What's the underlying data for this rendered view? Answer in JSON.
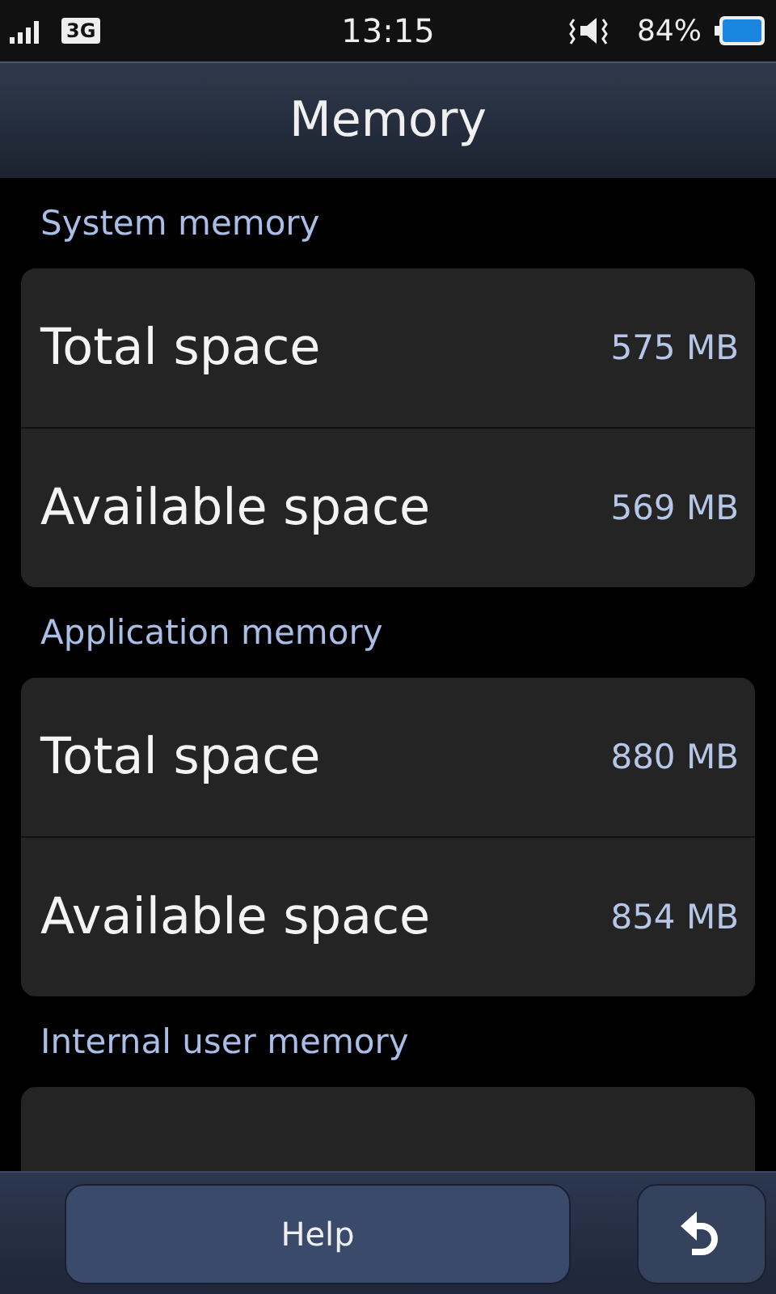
{
  "status_bar": {
    "network": "3G",
    "time": "13:15",
    "battery": "84%"
  },
  "title": "Memory",
  "sections": [
    {
      "heading": "System memory",
      "rows": [
        {
          "label": "Total space",
          "value": "575 MB"
        },
        {
          "label": "Available space",
          "value": "569 MB"
        }
      ]
    },
    {
      "heading": "Application memory",
      "rows": [
        {
          "label": "Total space",
          "value": "880 MB"
        },
        {
          "label": "Available space",
          "value": "854 MB"
        }
      ]
    },
    {
      "heading": "Internal user memory"
    }
  ],
  "bottom_bar": {
    "help": "Help"
  }
}
